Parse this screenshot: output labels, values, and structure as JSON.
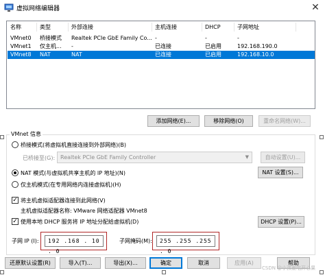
{
  "window": {
    "title": "虚拟网络编辑器",
    "close_label": "✕"
  },
  "grid": {
    "columns": [
      "名称",
      "类型",
      "外部连接",
      "主机连接",
      "DHCP",
      "子网地址"
    ],
    "rows": [
      {
        "name": "VMnet0",
        "type": "桥接模式",
        "external": "Realtek PCIe GbE Family Co...",
        "host": "-",
        "dhcp": "-",
        "subnet": "-",
        "selected": false
      },
      {
        "name": "VMnet1",
        "type": "仅主机...",
        "external": "-",
        "host": "已连接",
        "dhcp": "已启用",
        "subnet": "192.168.190.0",
        "selected": false
      },
      {
        "name": "VMnet8",
        "type": "NAT",
        "external": "NAT",
        "host": "已连接",
        "dhcp": "已启用",
        "subnet": "192.168.10.0",
        "selected": true
      }
    ]
  },
  "grid_buttons": {
    "add": "添加网络(E)...",
    "remove": "移除网络(O)",
    "rename": "重命名网络(W)..."
  },
  "vmnet": {
    "group_title": "VMnet 信息",
    "bridge_label": "桥接模式(将虚拟机直接连接到外部网络)(B)",
    "bridge_to_label": "已桥接至(G):",
    "bridge_to_value": "Realtek PCIe GbE Family Controller",
    "auto_settings": "自动设置(U)...",
    "nat_label": "NAT 模式(与虚拟机共享主机的 IP 地址)(N)",
    "nat_settings": "NAT 设置(S)...",
    "hostonly_label": "仅主机模式(在专用网络内连接虚拟机)(H)",
    "connect_adapter_label": "将主机虚拟适配器连接到此网络(V)",
    "adapter_name_label": "主机虚拟适配器名称: VMware 网络适配器 VMnet8",
    "dhcp_label": "使用本地 DHCP 服务将 IP 地址分配给虚拟机(D)",
    "dhcp_settings": "DHCP 设置(P)...",
    "subnet_ip_label": "子网 IP (I):",
    "subnet_ip_value": "192 .168 . 10  . 0",
    "subnet_mask_label": "子网掩码(M):",
    "subnet_mask_value": "255 .255 .255 . 0",
    "mode": "nat",
    "connect_adapter_checked": true,
    "dhcp_checked": true
  },
  "footer": {
    "restore": "还原默认设置(R)",
    "import": "导入(T)...",
    "export": "导出(X)...",
    "ok": "确定",
    "cancel": "取消",
    "apply": "应用(A)",
    "help": "帮助"
  },
  "watermark": "CSDN @小孩爱吃开心果",
  "colors": {
    "selection": "#0078d7",
    "highlight_box": "#b02525"
  }
}
